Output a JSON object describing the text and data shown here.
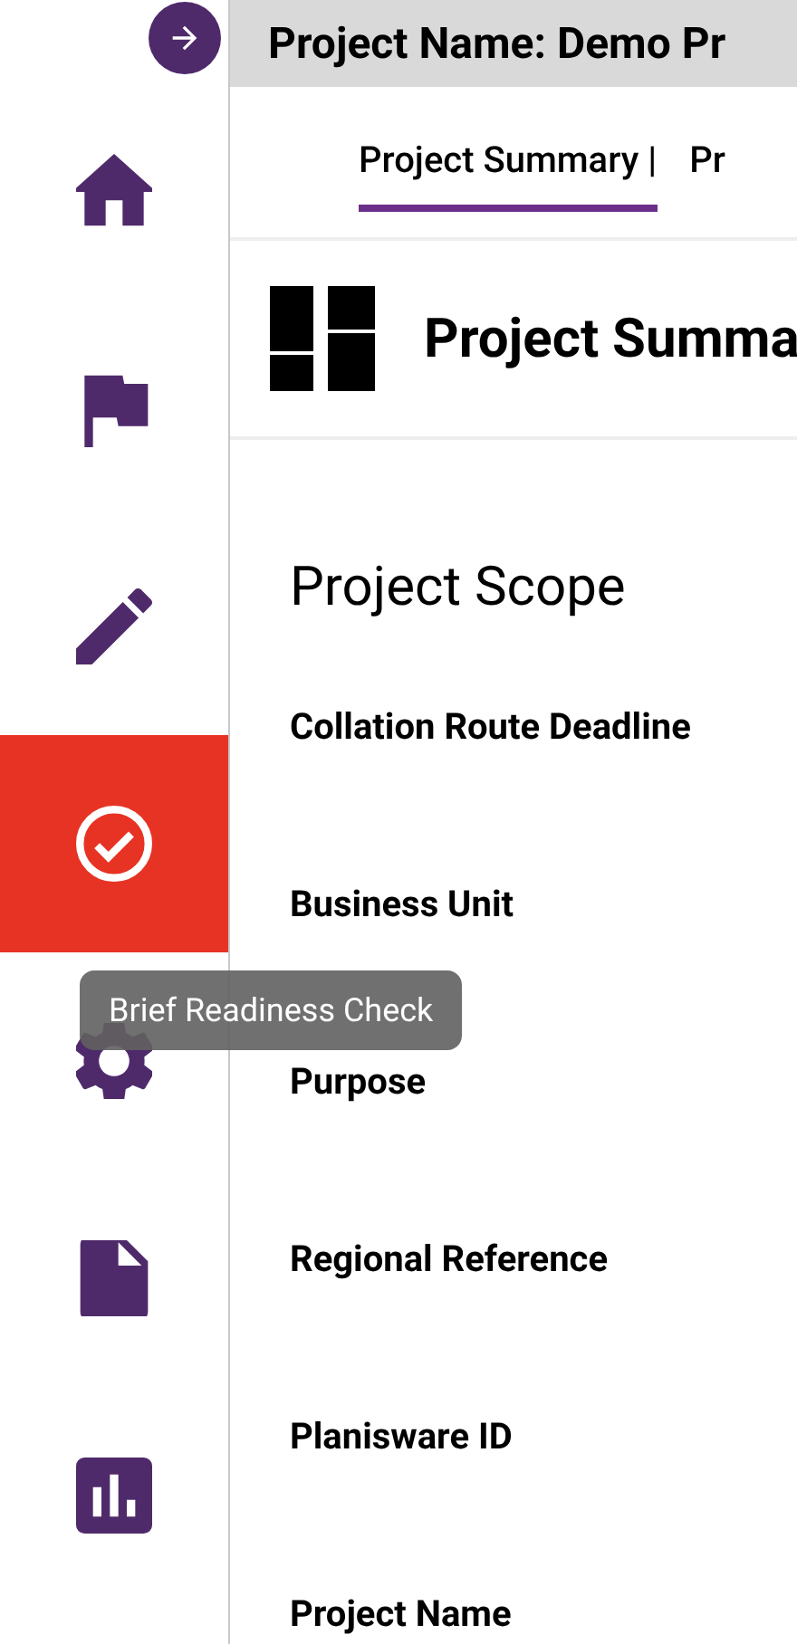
{
  "header": {
    "title": "Project Name: Demo Pr"
  },
  "sidebar": {
    "items": [
      {
        "kind": "home",
        "selected": false
      },
      {
        "kind": "flag",
        "selected": false
      },
      {
        "kind": "pencil",
        "selected": false
      },
      {
        "kind": "check",
        "selected": true
      },
      {
        "kind": "gear",
        "selected": false
      },
      {
        "kind": "file",
        "selected": false
      },
      {
        "kind": "chart",
        "selected": false
      }
    ]
  },
  "tooltip": "Brief Readiness Check",
  "tabs": [
    {
      "label": "Project Summary |",
      "selected": true
    },
    {
      "label": "Pr",
      "selected": false
    }
  ],
  "section": {
    "title": "Project Summa"
  },
  "scope": {
    "title": "Project Scope",
    "fields": [
      "Collation Route Deadline",
      "Business Unit",
      "Purpose",
      "Regional Reference",
      "Planisware ID",
      "Project Name"
    ]
  }
}
